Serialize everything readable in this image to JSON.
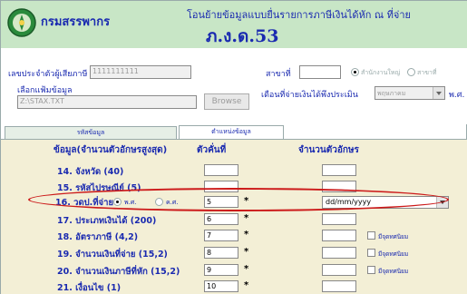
{
  "header": {
    "brand": "กรมสรรพากร",
    "title": "โอนย้ายข้อมูลแบบยื่นรายการภาษีเงินได้หัก ณ ที่จ่าย",
    "form_name": "ภ.ง.ด.53"
  },
  "form": {
    "tax_id_label": "เลขประจำตัวผู้เสียภาษี",
    "tax_id_value": "1111111111",
    "branch_label": "สาขาที่",
    "branch_value": "",
    "radio_branch_label": "สำนักงานใหญ่",
    "radio_branch2_label": "สาขาที่",
    "file_label": "เลือกแฟ้มข้อมูล",
    "file_path": "Z:\\STAX.TXT",
    "browse_label": "Browse",
    "month_label": "เดือนที่จ่ายเงินได้พึงประเมิน",
    "month_value": "พฤษภาคม",
    "year_label": "พ.ศ."
  },
  "tabs": [
    {
      "label": "รหัสข้อมูล"
    },
    {
      "label": "ตำแหน่งข้อมูล"
    }
  ],
  "table": {
    "col_data": "ข้อมูล(จำนวนตัวอักษรสูงสุด)",
    "col_position": "ตัวคั่นที่",
    "col_length": "จำนวนตัวอักษร",
    "rows": [
      {
        "label": "14. จังหวัด (40)",
        "position": "",
        "length": ""
      },
      {
        "label": "15. รหัสไปรษณีย์ (5)",
        "position": "",
        "length": ""
      },
      {
        "label": "16. วดป.ที่จ่าย",
        "position": "5",
        "length": "",
        "date_format": "dd/mm/yyyy",
        "era_ce": "พ.ศ.",
        "era_be": "ค.ศ."
      },
      {
        "label": "17. ประเภทเงินได้ (200)",
        "position": "6",
        "length": ""
      },
      {
        "label": "18. อัตราภาษี (4,2)",
        "position": "7",
        "length": "",
        "checkbox_label": "มีจุดทศนิยม"
      },
      {
        "label": "19. จำนวนเงินที่จ่าย (15,2)",
        "position": "8",
        "length": "",
        "checkbox_label": "มีจุดทศนิยม"
      },
      {
        "label": "20. จำนวนเงินภาษีที่หัก (15,2)",
        "position": "9",
        "length": "",
        "checkbox_label": "มีจุดทศนิยม"
      },
      {
        "label": "21. เงื่อนไข (1)",
        "position": "10",
        "length": ""
      }
    ],
    "star": "*"
  }
}
